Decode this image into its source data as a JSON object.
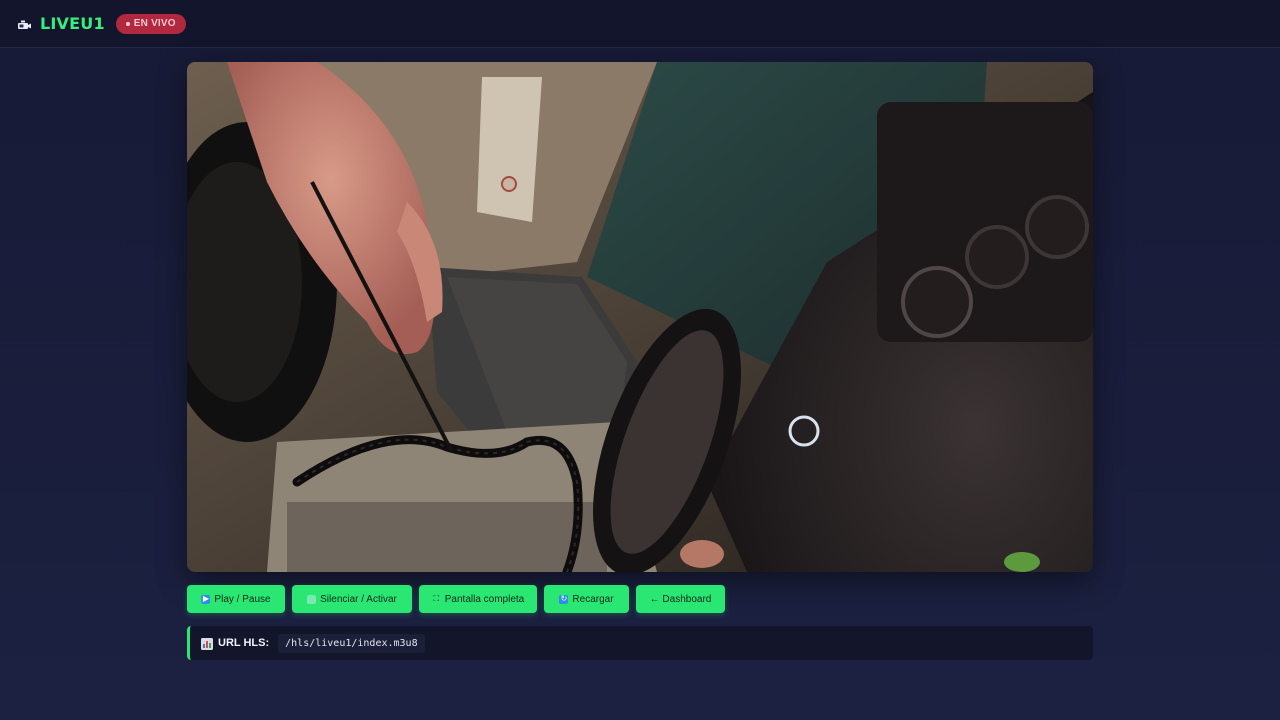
{
  "header": {
    "brand": "LIVEU1",
    "live_badge": "EN VIVO",
    "icon": "security-camera-icon"
  },
  "video": {
    "description_icon": "video-player"
  },
  "controls": [
    {
      "label": "Play / Pause",
      "icon": "play-icon"
    },
    {
      "label": "Silenciar / Activar",
      "icon": "speaker-icon"
    },
    {
      "label": "Pantalla completa",
      "icon": "fullscreen-icon"
    },
    {
      "label": "Recargar",
      "icon": "reload-icon"
    },
    {
      "label": "← Dashboard",
      "icon": ""
    }
  ],
  "stream": {
    "url_label": "URL HLS:",
    "url_value": "/hls/liveu1/index.m3u8",
    "icon": "bar-chart-icon"
  },
  "colors": {
    "accent": "#2ae673",
    "brand": "#35f07c",
    "live": "#b2283f",
    "background": "#1a1e3c"
  }
}
